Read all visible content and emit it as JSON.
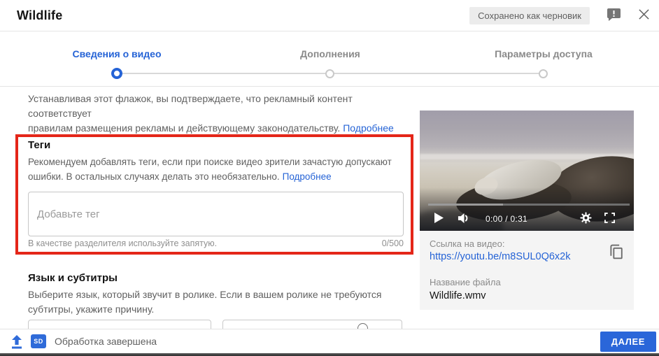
{
  "header": {
    "title": "Wildlife",
    "draft_badge": "Сохранено как черновик"
  },
  "stepper": {
    "steps": [
      {
        "label": "Сведения о видео",
        "active": true
      },
      {
        "label": "Дополнения",
        "active": false
      },
      {
        "label": "Параметры доступа",
        "active": false
      }
    ]
  },
  "main": {
    "ad_disclaimer": {
      "line1": "Устанавливая этот флажок, вы подтверждаете, что рекламный контент соответствует",
      "line2": "правилам размещения рекламы и действующему законодательству.",
      "more_link": "Подробнее"
    },
    "tags_section": {
      "title": "Теги",
      "description_line1": "Рекомендуем добавлять теги, если при поиске видео зрители зачастую допускают",
      "description_line2": "ошибки. В остальных случаях делать это необязательно.",
      "more_link": "Подробнее",
      "input_placeholder": "Добавьте тег",
      "helper_text": "В качестве разделителя используйте запятую.",
      "char_counter": "0/500"
    },
    "language_section": {
      "title": "Язык и субтитры",
      "description_line1": "Выберите язык, который звучит в ролике. Если в вашем ролике не требуются",
      "description_line2": "субтитры, укажите причину."
    }
  },
  "preview": {
    "player": {
      "time": "0:00 / 0:31"
    },
    "video_link_label": "Ссылка на видео:",
    "video_link": "https://youtu.be/m8SUL0Q6x2k",
    "file_name_label": "Название файла",
    "file_name": "Wildlife.wmv"
  },
  "footer": {
    "status": "Обработка завершена",
    "sd_badge": "SD",
    "next_button": "ДАЛЕЕ"
  },
  "icons": {
    "feedback": "speech-bubble-exclamation",
    "close": "x",
    "play": "triangle-right",
    "volume": "speaker-wave",
    "settings": "gear",
    "fullscreen": "corner-brackets",
    "copy": "overlapping-pages",
    "upload": "arrow-up-over-bar",
    "help": "circle"
  },
  "colors": {
    "accent_blue": "#2563d6",
    "button_blue": "#2a66d9",
    "highlight_red": "#e42619",
    "panel_gray": "#f4f4f4",
    "badge_gray": "#ececec",
    "bottom_strip": "#3f3f3f"
  }
}
